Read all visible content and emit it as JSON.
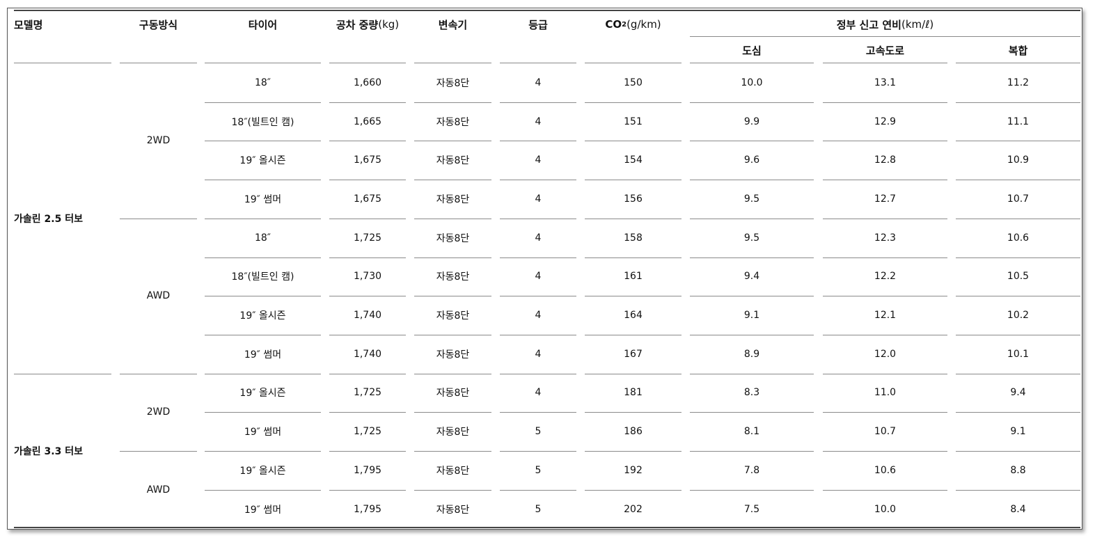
{
  "headers": {
    "model": "모델명",
    "drive": "구동방식",
    "tire": "타이어",
    "weight_main": "공차 중량",
    "weight_unit": "(kg)",
    "transmission": "변속기",
    "grade": "등급",
    "co2_main": "CO",
    "co2_sub": "2",
    "co2_unit": "(g/km)",
    "fuel_main": "정부 신고 연비",
    "fuel_unit": "(km/ℓ)",
    "city": "도심",
    "highway": "고속도로",
    "combined": "복합"
  },
  "models": [
    {
      "name": "가솔린 2.5 터보"
    },
    {
      "name": "가솔린 3.3 터보"
    }
  ],
  "drives": [
    {
      "name": "2WD"
    },
    {
      "name": "AWD"
    },
    {
      "name": "2WD"
    },
    {
      "name": "AWD"
    }
  ],
  "rows": [
    {
      "tire": "18″",
      "weight": "1,660",
      "trans": "자동8단",
      "grade": "4",
      "co2": "150",
      "city": "10.0",
      "highway": "13.1",
      "combined": "11.2"
    },
    {
      "tire": "18″(빌트인 캠)",
      "weight": "1,665",
      "trans": "자동8단",
      "grade": "4",
      "co2": "151",
      "city": "9.9",
      "highway": "12.9",
      "combined": "11.1"
    },
    {
      "tire": "19″ 올시즌",
      "weight": "1,675",
      "trans": "자동8단",
      "grade": "4",
      "co2": "154",
      "city": "9.6",
      "highway": "12.8",
      "combined": "10.9"
    },
    {
      "tire": "19″ 썸머",
      "weight": "1,675",
      "trans": "자동8단",
      "grade": "4",
      "co2": "156",
      "city": "9.5",
      "highway": "12.7",
      "combined": "10.7"
    },
    {
      "tire": "18″",
      "weight": "1,725",
      "trans": "자동8단",
      "grade": "4",
      "co2": "158",
      "city": "9.5",
      "highway": "12.3",
      "combined": "10.6"
    },
    {
      "tire": "18″(빌트인 캠)",
      "weight": "1,730",
      "trans": "자동8단",
      "grade": "4",
      "co2": "161",
      "city": "9.4",
      "highway": "12.2",
      "combined": "10.5"
    },
    {
      "tire": "19″ 올시즌",
      "weight": "1,740",
      "trans": "자동8단",
      "grade": "4",
      "co2": "164",
      "city": "9.1",
      "highway": "12.1",
      "combined": "10.2"
    },
    {
      "tire": "19″ 썸머",
      "weight": "1,740",
      "trans": "자동8단",
      "grade": "4",
      "co2": "167",
      "city": "8.9",
      "highway": "12.0",
      "combined": "10.1"
    },
    {
      "tire": "19″ 올시즌",
      "weight": "1,725",
      "trans": "자동8단",
      "grade": "4",
      "co2": "181",
      "city": "8.3",
      "highway": "11.0",
      "combined": "9.4"
    },
    {
      "tire": "19″ 썸머",
      "weight": "1,725",
      "trans": "자동8단",
      "grade": "5",
      "co2": "186",
      "city": "8.1",
      "highway": "10.7",
      "combined": "9.1"
    },
    {
      "tire": "19″ 올시즌",
      "weight": "1,795",
      "trans": "자동8단",
      "grade": "5",
      "co2": "192",
      "city": "7.8",
      "highway": "10.6",
      "combined": "8.8"
    },
    {
      "tire": "19″ 썸머",
      "weight": "1,795",
      "trans": "자동8단",
      "grade": "5",
      "co2": "202",
      "city": "7.5",
      "highway": "10.0",
      "combined": "8.4"
    }
  ]
}
